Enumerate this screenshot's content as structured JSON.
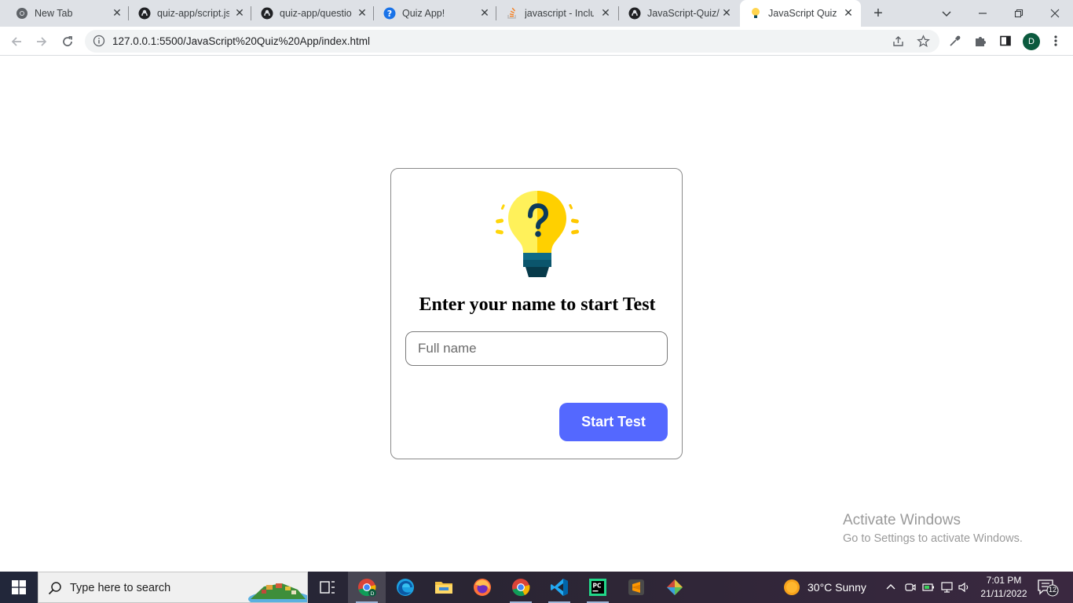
{
  "browser": {
    "tabs": [
      {
        "title": "New Tab",
        "icon": "chrome-icon"
      },
      {
        "title": "quiz-app/script.js",
        "icon": "github-icon"
      },
      {
        "title": "quiz-app/questions",
        "icon": "github-icon"
      },
      {
        "title": "Quiz App!",
        "icon": "question-icon"
      },
      {
        "title": "javascript - Include",
        "icon": "stackoverflow-icon"
      },
      {
        "title": "JavaScript-Quiz/",
        "icon": "github-icon"
      },
      {
        "title": "JavaScript Quiz",
        "icon": "lightbulb-icon"
      }
    ],
    "address": "127.0.0.1:5500/JavaScript%20Quiz%20App/index.html",
    "profile_initial": "D"
  },
  "page": {
    "heading": "Enter your name to start Test",
    "name_placeholder": "Full name",
    "start_label": "Start Test"
  },
  "watermark": {
    "line1": "Activate Windows",
    "line2": "Go to Settings to activate Windows."
  },
  "taskbar": {
    "search_placeholder": "Type here to search",
    "weather": "30°C  Sunny",
    "time": "7:01 PM",
    "date": "21/11/2022",
    "notification_count": "12"
  },
  "colors": {
    "accent": "#5468ff",
    "tabstrip": "#dee1e6"
  }
}
